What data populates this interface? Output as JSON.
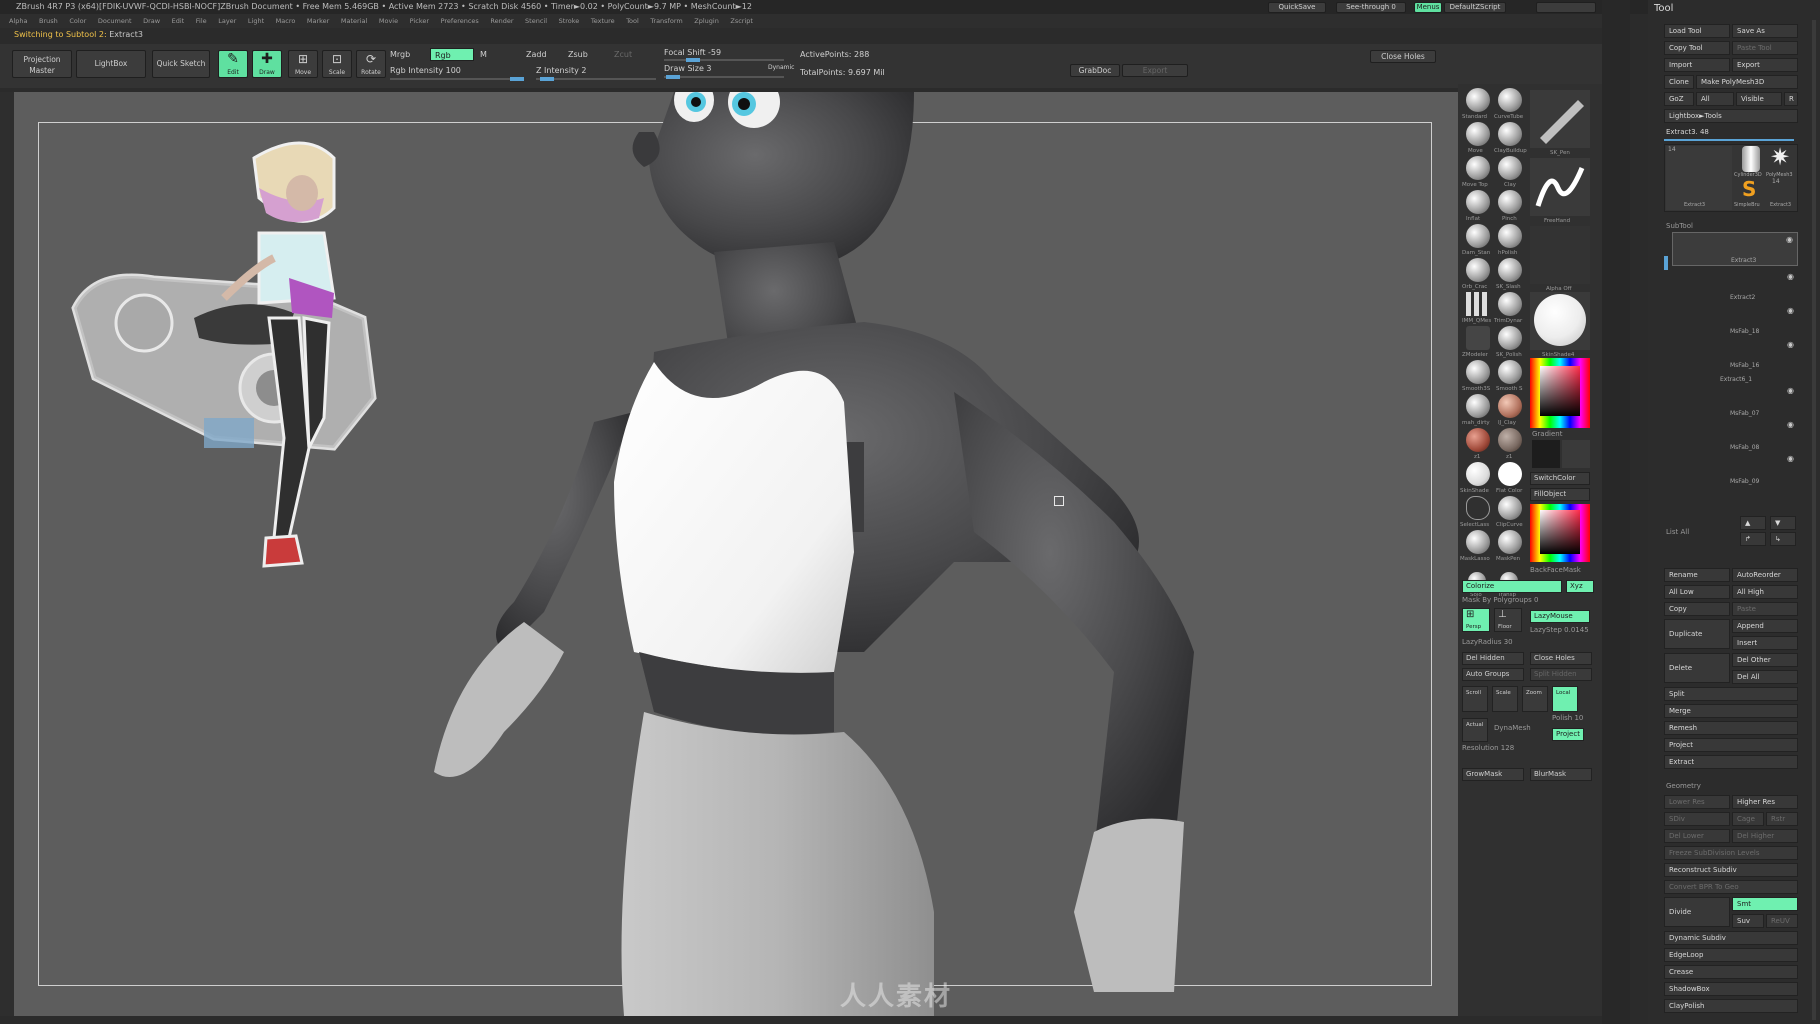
{
  "title_bar": {
    "text": "ZBrush 4R7 P3 (x64)[FDIK-UVWF-QCDI-HSBI-NOCF]ZBrush Document      • Free Mem 5.469GB • Active Mem 2723 • Scratch Disk 4560 • Timer►0.02 • PolyCount►9.7 MP • MeshCount►12",
    "quicksave": "QuickSave",
    "see_through": "See-through  0",
    "menus": "Menus",
    "default_zscript": "DefaultZScript"
  },
  "menus": [
    "Alpha",
    "Brush",
    "Color",
    "Document",
    "Draw",
    "Edit",
    "File",
    "Layer",
    "Light",
    "Macro",
    "Marker",
    "Material",
    "Movie",
    "Picker",
    "Preferences",
    "Render",
    "Stencil",
    "Stroke",
    "Texture",
    "Tool",
    "Transform",
    "Zplugin",
    "Zscript"
  ],
  "status": {
    "prefix": "Switching to Subtool 2:",
    "value": "Extract3"
  },
  "toolbar": {
    "projection_master": "Projection Master",
    "lightbox": "LightBox",
    "quick_sketch": "Quick Sketch",
    "edit": "Edit",
    "draw": "Draw",
    "move": "Move",
    "scale": "Scale",
    "rotate": "Rotate",
    "mrgb": "Mrgb",
    "rgb": "Rgb",
    "m": "M",
    "rgb_intensity": "Rgb Intensity 100",
    "zadd": "Zadd",
    "zsub": "Zsub",
    "zcut": "Zcut",
    "z_intensity": "Z Intensity 2",
    "focal_shift": "Focal Shift -59",
    "draw_size": "Draw Size 3",
    "dynamic": "Dynamic",
    "active_points": "ActivePoints: 288",
    "total_points": "TotalPoints: 9.697 Mil",
    "grabdoc": "GrabDoc",
    "export": "Export",
    "close_holes": "Close Holes"
  },
  "brush_palette": {
    "brushes": [
      "Standard",
      "CurveTube",
      "Move",
      "ClayBuildup",
      "Move Top",
      "Clay",
      "Inflat",
      "Pinch",
      "Dam_Stan",
      "hPolish",
      "Orb_Crac",
      "SK_Slash",
      "IMM_QMes",
      "TrimDynar",
      "ZModeler",
      "SK_Polish",
      "Smooth3S",
      "Smooth S",
      "mah_dirty",
      "IJ_Clay",
      "z1",
      "z1",
      "SkinShade",
      "Flat Color",
      "SelectLass",
      "ClipCurve",
      "MaskLasso",
      "MaskPen",
      "Solo",
      "Transp"
    ],
    "pen_label": "SK_Pen",
    "freehand": "FreeHand",
    "alpha_off": "Alpha Off",
    "material": "SkinShade4",
    "gradient": "Gradient",
    "switch_color": "SwitchColor",
    "fill_object": "FillObject",
    "backface_mask": "BackFaceMask",
    "colorize": "Colorize",
    "xyz": "Xyz",
    "mask_by_polygroups": "Mask By Polygroups 0",
    "persp": "Persp",
    "floor": "Floor",
    "lazymouse": "LazyMouse",
    "lazystep": "LazyStep 0.0145",
    "lazyradius": "LazyRadius 30",
    "del_hidden": "Del Hidden",
    "close_holes": "Close Holes",
    "auto_groups": "Auto Groups",
    "split_hidden": "Split Hidden",
    "local": "Local",
    "dynamesh": "DynaMesh",
    "polish": "Polish 10",
    "project": "Project",
    "resolution": "Resolution 128",
    "grow_mask": "GrowMask",
    "blur_mask": "BlurMask",
    "scroll": "Scroll",
    "zoom": "Zoom",
    "actual": "Actual"
  },
  "tool_panel": {
    "header": "Tool",
    "load_tool": "Load Tool",
    "save_as": "Save As",
    "copy_tool": "Copy Tool",
    "paste_tool": "Paste Tool",
    "import": "Import",
    "export": "Export",
    "clone": "Clone",
    "make_polymesh": "Make PolyMesh3D",
    "goz": "GoZ",
    "all": "All",
    "visible": "Visible",
    "r": "R",
    "lightbox_tools": "Lightbox►Tools",
    "current_tool": "Extract3. 48",
    "thumbs": [
      "Extract3",
      "Cylinder3D",
      "PolyMesh3",
      "SimpleBru",
      "Extract3"
    ],
    "thumb_counts": [
      "14",
      "14"
    ],
    "subtool_head": "SubTool",
    "subtools": [
      "Extract3",
      "Extract2",
      "MsFab_18",
      "MsFab_16",
      "Extract6_1",
      "MsFab_07",
      "MsFab_08",
      "MsFab_09"
    ],
    "list_all": "List All",
    "rename": "Rename",
    "autoreorder": "AutoReorder",
    "all_low": "All Low",
    "all_high": "All High",
    "copy": "Copy",
    "paste": "Paste",
    "duplicate": "Duplicate",
    "append": "Append",
    "insert": "Insert",
    "delete": "Delete",
    "del_other": "Del Other",
    "del_all": "Del All",
    "split": "Split",
    "merge": "Merge",
    "remesh": "Remesh",
    "project": "Project",
    "extract": "Extract",
    "geometry_head": "Geometry",
    "lower_res": "Lower Res",
    "higher_res": "Higher Res",
    "sdiv": "SDiv",
    "cage": "Cage",
    "rstr": "Rstr",
    "del_lower": "Del Lower",
    "del_higher": "Del Higher",
    "freeze_subdiv": "Freeze SubDivision Levels",
    "reconstruct_subdiv": "Reconstruct Subdiv",
    "convert_bpr": "Convert BPR To Geo",
    "divide": "Divide",
    "smt": "Smt",
    "suv": "Suv",
    "reuv": "ReUV",
    "dynamic_subdiv": "Dynamic Subdiv",
    "edgeloop": "EdgeLoop",
    "crease": "Crease",
    "shadowbox": "ShadowBox",
    "claypolish": "ClayPolish"
  },
  "watermark": "人人素材"
}
